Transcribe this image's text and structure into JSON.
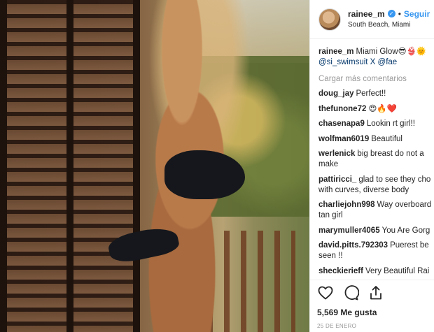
{
  "post": {
    "username": "rainee_m",
    "follow_label": "Seguir",
    "separator": "•",
    "location": "South Beach, Miami",
    "caption_text": "Miami Glow",
    "caption_emoji": "😎👙🌞",
    "caption_mentions": "@si_swimsuit X @fae",
    "load_more": "Cargar más comentarios",
    "likes": "5,569 Me gusta",
    "date": "25 DE ENERO"
  },
  "comments": [
    {
      "user": "doug_jay",
      "text": "Perfect!!"
    },
    {
      "user": "thefunone72",
      "text": "😍🔥❤️"
    },
    {
      "user": "chasenapa9",
      "text": "Lookin rt girl!!"
    },
    {
      "user": "wolfman6019",
      "text": "Beautiful"
    },
    {
      "user": "werlenick",
      "text": "big breast do not a make"
    },
    {
      "user": "pattiricci_",
      "text": "glad to see they cho with curves, diverse body"
    },
    {
      "user": "charliejohn998",
      "text": "Way overboard tan girl"
    },
    {
      "user": "marymuller4065",
      "text": "You Are Gorg"
    },
    {
      "user": "david.pitts.792303",
      "text": "Puerest be seen !!"
    },
    {
      "user": "sheckierieff",
      "text": "Very Beautiful Rai"
    }
  ],
  "icons": [
    "heart-icon",
    "comment-icon",
    "share-icon"
  ],
  "colors": {
    "link": "#3897f0",
    "mention": "#003569",
    "muted": "#999999"
  }
}
